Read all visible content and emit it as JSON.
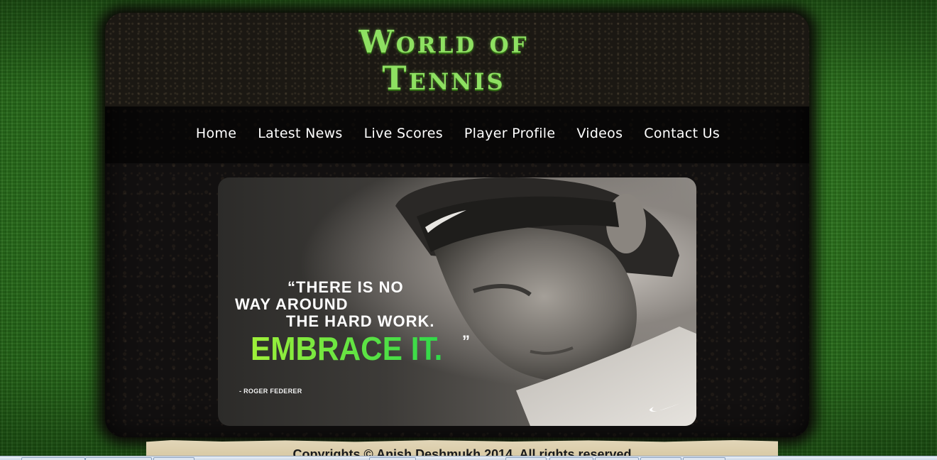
{
  "site": {
    "logo_line1": "World of",
    "logo_line2": "Tennis"
  },
  "nav": {
    "items": [
      {
        "label": "Home"
      },
      {
        "label": "Latest News"
      },
      {
        "label": "Live Scores"
      },
      {
        "label": "Player Profile"
      },
      {
        "label": "Videos"
      },
      {
        "label": "Contact Us"
      }
    ]
  },
  "banner": {
    "quote_line1": "“THERE IS NO",
    "quote_line2": "WAY AROUND",
    "quote_line3": "THE HARD WORK.",
    "quote_line4": "EMBRACE IT.",
    "quote_close": "”",
    "author": "- ROGER FEDERER",
    "accent_color": "#5fe82a"
  },
  "footer": {
    "text": "Copyrights © Anish Deshmukh 2014. All rights reserved"
  },
  "colors": {
    "grass": "#2f7a1f",
    "panel": "#121010",
    "logo_green": "#8ee062"
  }
}
